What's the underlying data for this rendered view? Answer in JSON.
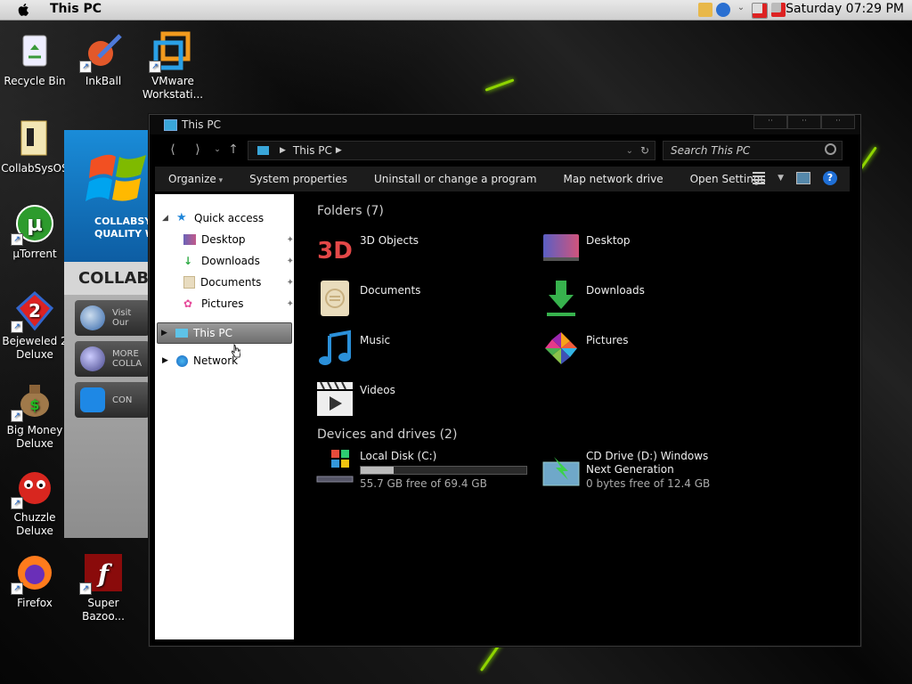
{
  "menubar": {
    "title": "This PC",
    "clock": "Saturday 07:29 PM"
  },
  "desktop": {
    "icons": [
      {
        "label": "Recycle Bin"
      },
      {
        "label": "InkBall"
      },
      {
        "label": "VMware Workstati..."
      },
      {
        "label": "CollabSysOS"
      },
      {
        "label": "µTorrent"
      },
      {
        "label": "Bejeweled 2 Deluxe"
      },
      {
        "label": "Big Money Deluxe"
      },
      {
        "label": "Chuzzle Deluxe"
      },
      {
        "label": "Firefox"
      },
      {
        "label": "Super Bazoo..."
      }
    ]
  },
  "bgapp": {
    "banner_text": "COLLABSY\nQUALITY WIT",
    "heading": "COLLABS",
    "buttons": [
      "Visit Our",
      "MORE COLLA",
      "CON"
    ]
  },
  "window": {
    "title": "This PC",
    "address": {
      "crumb": "This PC"
    },
    "search": {
      "placeholder": "Search This PC"
    },
    "toolbar": {
      "organize": "Organize",
      "system_properties": "System properties",
      "uninstall": "Uninstall or change a program",
      "map_drive": "Map network drive",
      "open_settings": "Open Settings"
    },
    "nav": {
      "quick_access": "Quick access",
      "desktop": "Desktop",
      "downloads": "Downloads",
      "documents": "Documents",
      "pictures": "Pictures",
      "this_pc": "This PC",
      "network": "Network"
    },
    "folders_header": "Folders (7)",
    "folders": [
      {
        "label": "3D Objects"
      },
      {
        "label": "Desktop"
      },
      {
        "label": "Documents"
      },
      {
        "label": "Downloads"
      },
      {
        "label": "Music"
      },
      {
        "label": "Pictures"
      },
      {
        "label": "Videos"
      }
    ],
    "devices_header": "Devices and drives (2)",
    "drives": [
      {
        "name": "Local Disk (C:)",
        "free": "55.7 GB free of 69.4 GB",
        "used_fraction": 0.2
      },
      {
        "name": "CD Drive (D:) Windows Next Generation",
        "free": "0 bytes free of 12.4 GB"
      }
    ]
  }
}
